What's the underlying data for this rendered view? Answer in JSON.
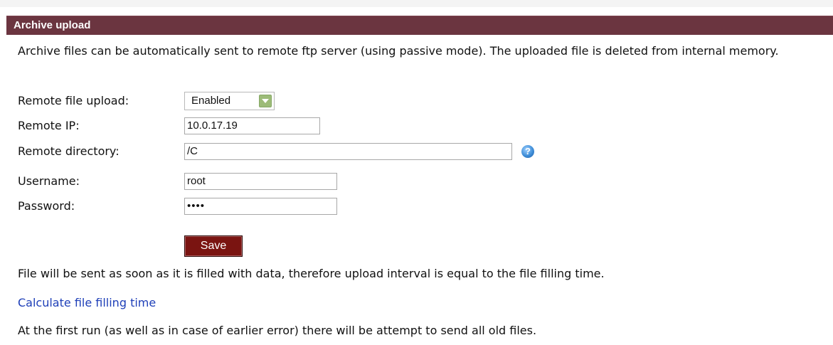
{
  "header": {
    "title": "Archive upload"
  },
  "intro": {
    "text": "Archive files can be automatically sent to remote ftp server (using passive mode). The uploaded file is deleted from internal memory."
  },
  "form": {
    "upload": {
      "label": "Remote file upload:",
      "value": "Enabled",
      "options": [
        "Enabled"
      ]
    },
    "ip": {
      "label": "Remote IP:",
      "value": "10.0.17.19"
    },
    "directory": {
      "label": "Remote directory:",
      "value": "/C",
      "help_icon": "question-help-icon"
    },
    "username": {
      "label": "Username:",
      "value": "root"
    },
    "password": {
      "label": "Password:",
      "value": "••••"
    },
    "save_label": "Save"
  },
  "notes": {
    "interval": "File will be sent as soon as it is filled with data, therefore upload interval is equal to the file filling time.",
    "calculate_link": "Calculate file filling time",
    "first_run": "At the first run (as well as in case of earlier error) there will be attempt to send all old files."
  },
  "colors": {
    "header_bg": "#6b3540",
    "save_bg": "#7a1411",
    "link": "#1e3fb8",
    "select_arrow": "#9cbb78"
  }
}
